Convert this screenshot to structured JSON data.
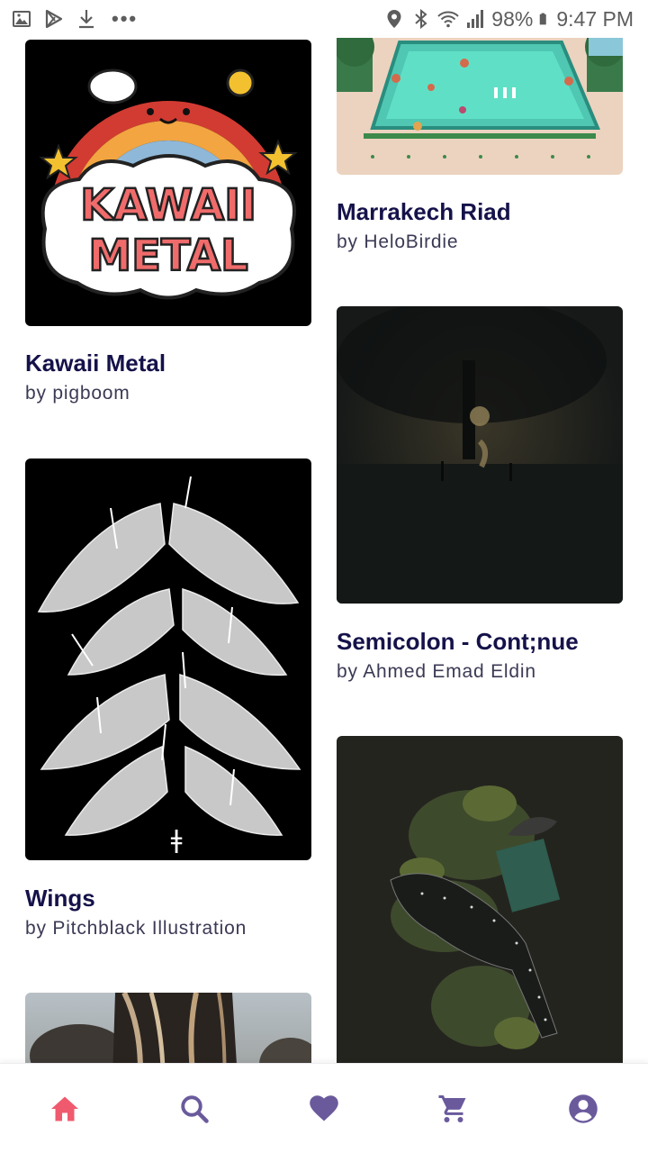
{
  "status_bar": {
    "battery": "98%",
    "time": "9:47 PM",
    "overflow": "•••"
  },
  "feed": {
    "items": [
      {
        "title": "Kawaii Metal",
        "author": "by pigboom",
        "art_text_1": "KAWAII",
        "art_text_2": "METAL"
      },
      {
        "title": "Marrakech Riad",
        "author": "by HeloBirdie"
      },
      {
        "title": "Wings",
        "author": "by Pitchblack Illustration",
        "art_symbol": "ǂ"
      },
      {
        "title": "Semicolon - Cont;nue",
        "author": "by Ahmed Emad Eldin"
      },
      {
        "title": "",
        "author": ""
      },
      {
        "title": "",
        "author": ""
      }
    ]
  },
  "bottom_nav": {
    "items": [
      "home-icon",
      "search-icon",
      "heart-icon",
      "cart-icon",
      "account-icon"
    ],
    "active": "home-icon"
  },
  "colors": {
    "accent": "#f05a6e",
    "nav_icon": "#6a5a9c",
    "title": "#15124a",
    "author": "#3b3a55"
  }
}
